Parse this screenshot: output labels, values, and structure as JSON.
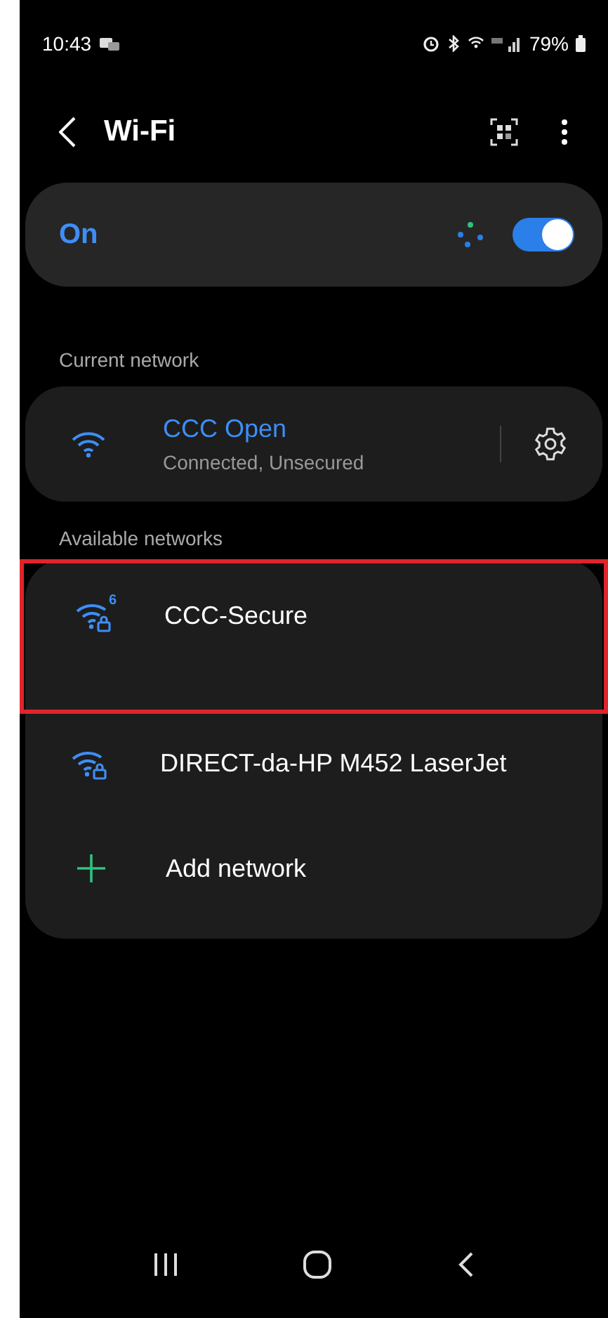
{
  "status_bar": {
    "time": "10:43",
    "battery": "79%"
  },
  "header": {
    "title": "Wi-Fi"
  },
  "master_switch": {
    "label": "On",
    "on": true
  },
  "current_network": {
    "heading": "Current network",
    "name": "CCC Open",
    "status": "Connected, Unsecured"
  },
  "available_networks": {
    "heading": "Available networks",
    "networks": [
      {
        "name": "CCC-Secure",
        "badge": "6",
        "secured": true,
        "highlighted": true
      },
      {
        "name": "DIRECT-da-HP M452 LaserJet",
        "secured": true,
        "highlighted": false
      }
    ],
    "add_label": "Add network"
  }
}
